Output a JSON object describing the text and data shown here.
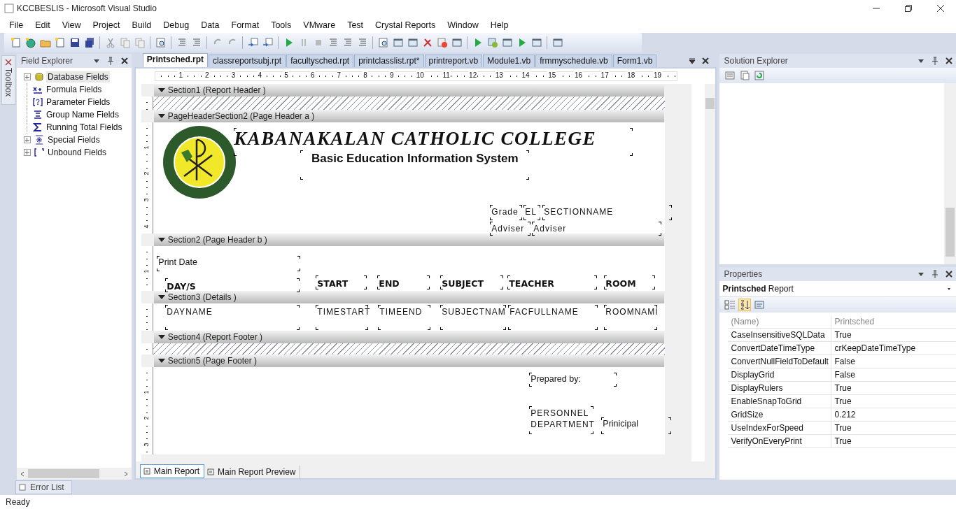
{
  "window": {
    "title": "KCCBESLIS - Microsoft Visual Studio"
  },
  "menu": [
    "File",
    "Edit",
    "View",
    "Project",
    "Build",
    "Debug",
    "Data",
    "Format",
    "Tools",
    "VMware",
    "Test",
    "Crystal Reports",
    "Window",
    "Help"
  ],
  "toolbox_tab": "Toolbox",
  "field_explorer": {
    "title": "Field Explorer",
    "items": [
      {
        "label": "Database Fields",
        "kind": "database",
        "expandable": true,
        "selected": true
      },
      {
        "label": "Formula Fields",
        "kind": "formula",
        "expandable": false,
        "selected": false
      },
      {
        "label": "Parameter Fields",
        "kind": "parameter",
        "expandable": false,
        "selected": false
      },
      {
        "label": "Group Name Fields",
        "kind": "group",
        "expandable": false,
        "selected": false
      },
      {
        "label": "Running Total Fields",
        "kind": "total",
        "expandable": false,
        "selected": false
      },
      {
        "label": "Special Fields",
        "kind": "special",
        "expandable": true,
        "selected": false
      },
      {
        "label": "Unbound Fields",
        "kind": "unbound",
        "expandable": true,
        "selected": false
      }
    ]
  },
  "document_tabs": [
    {
      "label": "Printsched.rpt",
      "selected": true
    },
    {
      "label": "classreportsubj.rpt",
      "selected": false
    },
    {
      "label": "facultysched.rpt",
      "selected": false
    },
    {
      "label": "printclasslist.rpt*",
      "selected": false
    },
    {
      "label": "printreport.vb",
      "selected": false
    },
    {
      "label": "Module1.vb",
      "selected": false
    },
    {
      "label": "frmmyschedule.vb",
      "selected": false
    },
    {
      "label": "Form1.vb",
      "selected": false
    }
  ],
  "ruler": [
    "1",
    "2",
    "3",
    "4",
    "5",
    "6",
    "7",
    "8",
    "9",
    "10",
    "11",
    "12",
    "13",
    "14",
    "15",
    "16",
    "17",
    "18",
    "19"
  ],
  "sections": [
    {
      "title": "Section1 (Report Header  )",
      "suppressed": true
    },
    {
      "title": "PageHeaderSection2 (Page Header a )",
      "suppressed": false,
      "ruler": [
        "1",
        "2",
        "3",
        "4"
      ],
      "logo": true,
      "fields": [
        {
          "text": "KABANAKALAN CATHOLIC COLLEGE",
          "kind": "title"
        },
        {
          "text": "Basic Education Information System",
          "kind": "subtitle"
        },
        {
          "text": "Grade",
          "kind": "text"
        },
        {
          "text": "EL",
          "kind": "text"
        },
        {
          "text": "SECTIONNAME",
          "kind": "text"
        },
        {
          "text": "Adviser",
          "kind": "text"
        },
        {
          "text": "Adviser",
          "kind": "text"
        }
      ]
    },
    {
      "title": "Section2 (Page Header b )",
      "suppressed": false,
      "ruler": [
        "1"
      ],
      "fields": [
        {
          "text": "Print Date",
          "kind": "label"
        },
        {
          "text": "DAY/S",
          "kind": "heading"
        },
        {
          "text": "START",
          "kind": "heading"
        },
        {
          "text": "END",
          "kind": "heading"
        },
        {
          "text": "SUBJECT",
          "kind": "heading"
        },
        {
          "text": "TEACHER",
          "kind": "heading"
        },
        {
          "text": "ROOM",
          "kind": "heading"
        }
      ]
    },
    {
      "title": "Section3 (Details  )",
      "suppressed": false,
      "fields": [
        {
          "text": "DAYNAME",
          "kind": "text"
        },
        {
          "text": "TIMESTART",
          "kind": "text"
        },
        {
          "text": "TIMEEND",
          "kind": "text"
        },
        {
          "text": "SUBJECTNAM",
          "kind": "text"
        },
        {
          "text": "FACFULLNAME",
          "kind": "text"
        },
        {
          "text": "ROOMNAMI",
          "kind": "text"
        }
      ]
    },
    {
      "title": "Section4 (Report Footer  )",
      "suppressed": true
    },
    {
      "title": "Section5 (Page Footer  )",
      "suppressed": false,
      "ruler": [
        "1",
        "2",
        "3"
      ],
      "fields": [
        {
          "text": "Prepared by:",
          "kind": "label"
        },
        {
          "text": "PERSONNEL DEPARTMENT",
          "kind": "text"
        },
        {
          "text": "Prinicipal",
          "kind": "label"
        }
      ]
    }
  ],
  "report_tabs": [
    {
      "label": "Main Report",
      "selected": true
    },
    {
      "label": "Main Report Preview",
      "selected": false
    }
  ],
  "solution_explorer": {
    "title": "Solution Explorer"
  },
  "properties": {
    "title": "Properties",
    "object_name": "Printsched",
    "object_type": "Report",
    "rows": [
      {
        "name": "(Name)",
        "value": "Printsched",
        "disabled": true
      },
      {
        "name": "CaseInsensitiveSQLData",
        "value": "True",
        "disabled": false
      },
      {
        "name": "ConvertDateTimeType",
        "value": "crKeepDateTimeType",
        "disabled": false
      },
      {
        "name": "ConvertNullFieldToDefault",
        "value": "False",
        "disabled": false
      },
      {
        "name": "DisplayGrid",
        "value": "False",
        "disabled": false
      },
      {
        "name": "DisplayRulers",
        "value": "True",
        "disabled": false
      },
      {
        "name": "EnableSnapToGrid",
        "value": "True",
        "disabled": false
      },
      {
        "name": "GridSize",
        "value": "0.212",
        "disabled": false
      },
      {
        "name": "UseIndexForSpeed",
        "value": "True",
        "disabled": false
      },
      {
        "name": "VerifyOnEveryPrint",
        "value": "True",
        "disabled": false
      }
    ]
  },
  "bottom_tabs": [
    "Error List"
  ],
  "status_bar": {
    "text": "Ready"
  }
}
